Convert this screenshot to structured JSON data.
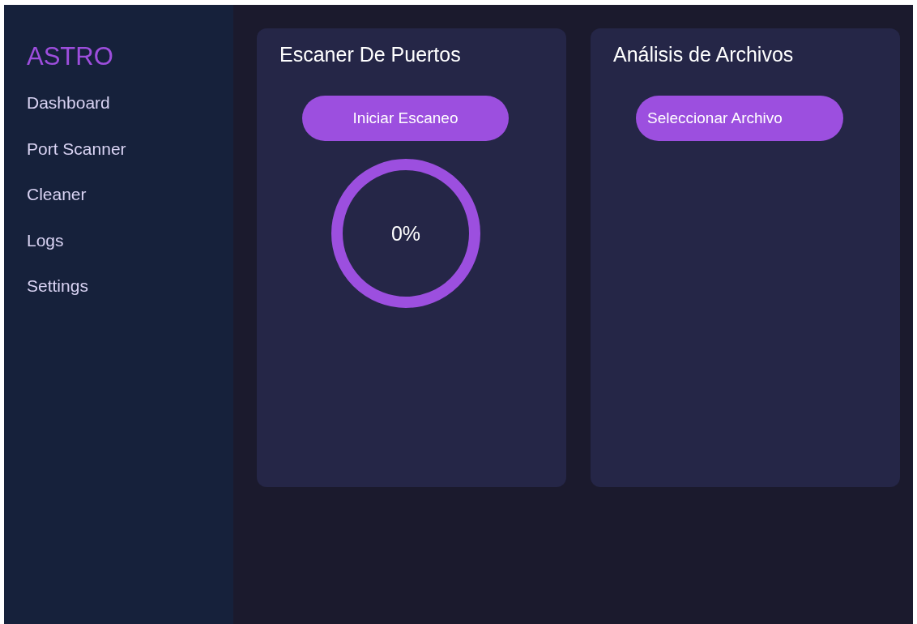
{
  "sidebar": {
    "logo": "ASTRO",
    "items": [
      {
        "label": "Dashboard",
        "selected": false
      },
      {
        "label": "Port Scanner",
        "selected": false
      },
      {
        "label": "Cleaner",
        "selected": false
      },
      {
        "label": "Logs",
        "selected": false
      },
      {
        "label": "Settings",
        "selected": false
      }
    ]
  },
  "cards": [
    {
      "kind": "scanner",
      "title": "Escaner De Puertos",
      "button": "Iniciar Escaneo",
      "progress": {
        "level": 0,
        "reading": "0%"
      }
    },
    {
      "kind": "files",
      "title": "Análisis de Archivos",
      "button": "Seleccionar Archivo"
    }
  ]
}
